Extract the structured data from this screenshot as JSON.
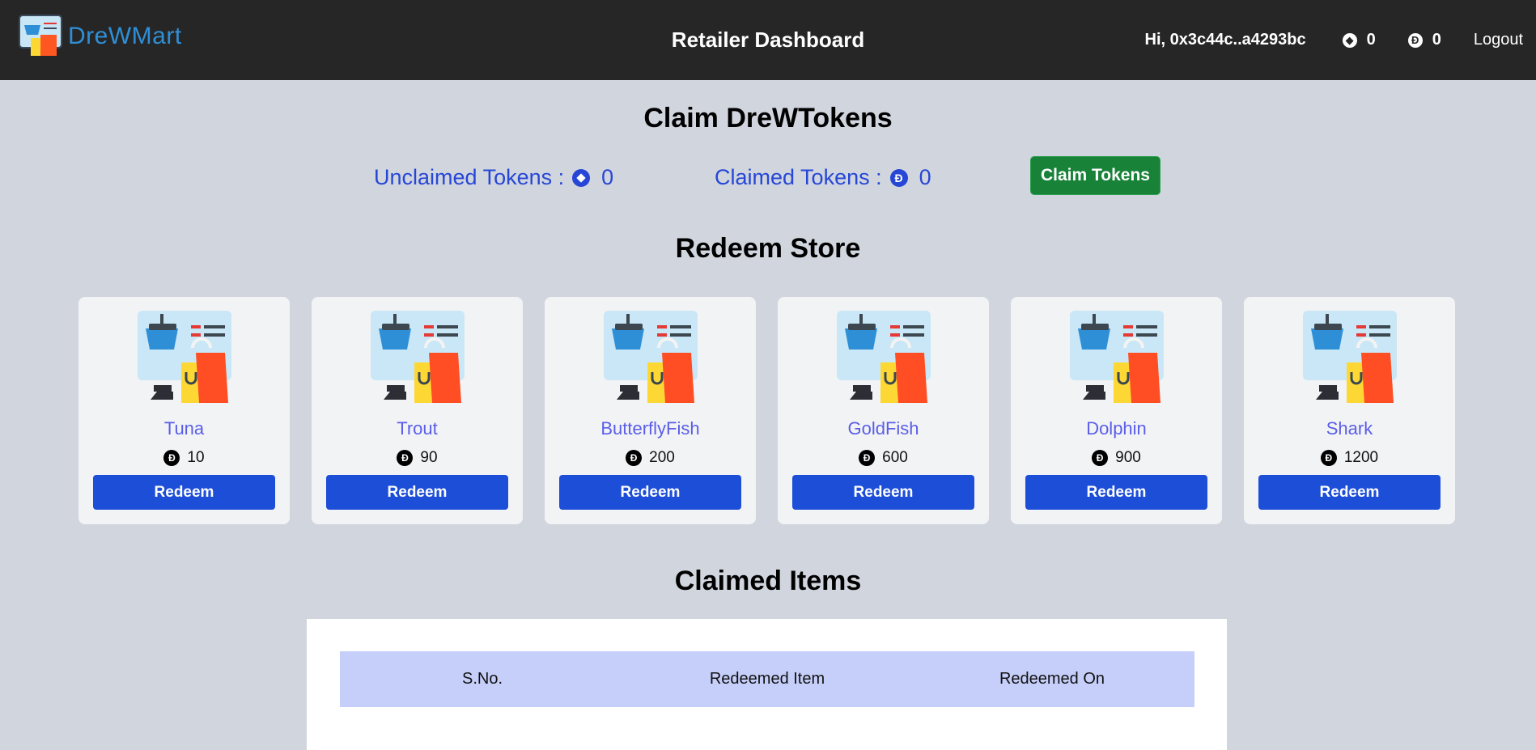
{
  "navbar": {
    "logo_text": "DreWMart",
    "title": "Retailer Dashboard",
    "user_greeting": "Hi, 0x3c44c..a4293bc",
    "unclaimed_count": "0",
    "claimed_count": "0",
    "logout_label": "Logout"
  },
  "claim_section": {
    "heading": "Claim DreWTokens",
    "unclaimed_label": "Unclaimed Tokens :",
    "unclaimed_value": "0",
    "claimed_label": "Claimed Tokens :",
    "claimed_value": "0",
    "claim_button": "Claim Tokens"
  },
  "store": {
    "heading": "Redeem Store",
    "items": [
      {
        "name": "Tuna",
        "price": "10",
        "button": "Redeem"
      },
      {
        "name": "Trout",
        "price": "90",
        "button": "Redeem"
      },
      {
        "name": "ButterflyFish",
        "price": "200",
        "button": "Redeem"
      },
      {
        "name": "GoldFish",
        "price": "600",
        "button": "Redeem"
      },
      {
        "name": "Dolphin",
        "price": "900",
        "button": "Redeem"
      },
      {
        "name": "Shark",
        "price": "1200",
        "button": "Redeem"
      }
    ]
  },
  "claimed_items": {
    "heading": "Claimed Items",
    "columns": [
      "S.No.",
      "Redeemed Item",
      "Redeemed On"
    ]
  },
  "colors": {
    "navbar_bg": "#262626",
    "page_bg": "#d1d5de",
    "token_blue": "#2647d6",
    "claim_green": "#188238",
    "redeem_blue": "#1d4ed8",
    "item_name": "#5a5ee8",
    "table_header_bg": "#c6cffa"
  }
}
